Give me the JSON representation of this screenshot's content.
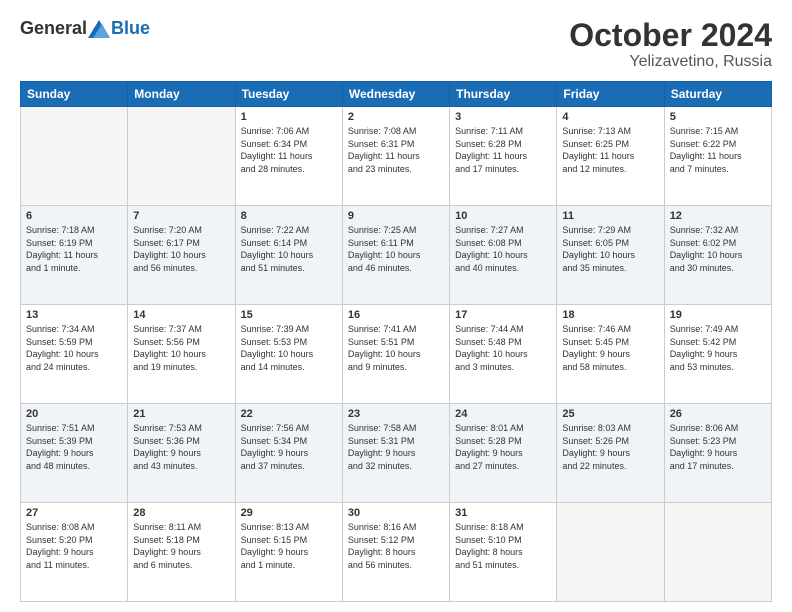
{
  "header": {
    "logo_general": "General",
    "logo_blue": "Blue",
    "month": "October 2024",
    "location": "Yelizavetino, Russia"
  },
  "days_of_week": [
    "Sunday",
    "Monday",
    "Tuesday",
    "Wednesday",
    "Thursday",
    "Friday",
    "Saturday"
  ],
  "weeks": [
    [
      {
        "day": "",
        "info": ""
      },
      {
        "day": "",
        "info": ""
      },
      {
        "day": "1",
        "info": "Sunrise: 7:06 AM\nSunset: 6:34 PM\nDaylight: 11 hours\nand 28 minutes."
      },
      {
        "day": "2",
        "info": "Sunrise: 7:08 AM\nSunset: 6:31 PM\nDaylight: 11 hours\nand 23 minutes."
      },
      {
        "day": "3",
        "info": "Sunrise: 7:11 AM\nSunset: 6:28 PM\nDaylight: 11 hours\nand 17 minutes."
      },
      {
        "day": "4",
        "info": "Sunrise: 7:13 AM\nSunset: 6:25 PM\nDaylight: 11 hours\nand 12 minutes."
      },
      {
        "day": "5",
        "info": "Sunrise: 7:15 AM\nSunset: 6:22 PM\nDaylight: 11 hours\nand 7 minutes."
      }
    ],
    [
      {
        "day": "6",
        "info": "Sunrise: 7:18 AM\nSunset: 6:19 PM\nDaylight: 11 hours\nand 1 minute."
      },
      {
        "day": "7",
        "info": "Sunrise: 7:20 AM\nSunset: 6:17 PM\nDaylight: 10 hours\nand 56 minutes."
      },
      {
        "day": "8",
        "info": "Sunrise: 7:22 AM\nSunset: 6:14 PM\nDaylight: 10 hours\nand 51 minutes."
      },
      {
        "day": "9",
        "info": "Sunrise: 7:25 AM\nSunset: 6:11 PM\nDaylight: 10 hours\nand 46 minutes."
      },
      {
        "day": "10",
        "info": "Sunrise: 7:27 AM\nSunset: 6:08 PM\nDaylight: 10 hours\nand 40 minutes."
      },
      {
        "day": "11",
        "info": "Sunrise: 7:29 AM\nSunset: 6:05 PM\nDaylight: 10 hours\nand 35 minutes."
      },
      {
        "day": "12",
        "info": "Sunrise: 7:32 AM\nSunset: 6:02 PM\nDaylight: 10 hours\nand 30 minutes."
      }
    ],
    [
      {
        "day": "13",
        "info": "Sunrise: 7:34 AM\nSunset: 5:59 PM\nDaylight: 10 hours\nand 24 minutes."
      },
      {
        "day": "14",
        "info": "Sunrise: 7:37 AM\nSunset: 5:56 PM\nDaylight: 10 hours\nand 19 minutes."
      },
      {
        "day": "15",
        "info": "Sunrise: 7:39 AM\nSunset: 5:53 PM\nDaylight: 10 hours\nand 14 minutes."
      },
      {
        "day": "16",
        "info": "Sunrise: 7:41 AM\nSunset: 5:51 PM\nDaylight: 10 hours\nand 9 minutes."
      },
      {
        "day": "17",
        "info": "Sunrise: 7:44 AM\nSunset: 5:48 PM\nDaylight: 10 hours\nand 3 minutes."
      },
      {
        "day": "18",
        "info": "Sunrise: 7:46 AM\nSunset: 5:45 PM\nDaylight: 9 hours\nand 58 minutes."
      },
      {
        "day": "19",
        "info": "Sunrise: 7:49 AM\nSunset: 5:42 PM\nDaylight: 9 hours\nand 53 minutes."
      }
    ],
    [
      {
        "day": "20",
        "info": "Sunrise: 7:51 AM\nSunset: 5:39 PM\nDaylight: 9 hours\nand 48 minutes."
      },
      {
        "day": "21",
        "info": "Sunrise: 7:53 AM\nSunset: 5:36 PM\nDaylight: 9 hours\nand 43 minutes."
      },
      {
        "day": "22",
        "info": "Sunrise: 7:56 AM\nSunset: 5:34 PM\nDaylight: 9 hours\nand 37 minutes."
      },
      {
        "day": "23",
        "info": "Sunrise: 7:58 AM\nSunset: 5:31 PM\nDaylight: 9 hours\nand 32 minutes."
      },
      {
        "day": "24",
        "info": "Sunrise: 8:01 AM\nSunset: 5:28 PM\nDaylight: 9 hours\nand 27 minutes."
      },
      {
        "day": "25",
        "info": "Sunrise: 8:03 AM\nSunset: 5:26 PM\nDaylight: 9 hours\nand 22 minutes."
      },
      {
        "day": "26",
        "info": "Sunrise: 8:06 AM\nSunset: 5:23 PM\nDaylight: 9 hours\nand 17 minutes."
      }
    ],
    [
      {
        "day": "27",
        "info": "Sunrise: 8:08 AM\nSunset: 5:20 PM\nDaylight: 9 hours\nand 11 minutes."
      },
      {
        "day": "28",
        "info": "Sunrise: 8:11 AM\nSunset: 5:18 PM\nDaylight: 9 hours\nand 6 minutes."
      },
      {
        "day": "29",
        "info": "Sunrise: 8:13 AM\nSunset: 5:15 PM\nDaylight: 9 hours\nand 1 minute."
      },
      {
        "day": "30",
        "info": "Sunrise: 8:16 AM\nSunset: 5:12 PM\nDaylight: 8 hours\nand 56 minutes."
      },
      {
        "day": "31",
        "info": "Sunrise: 8:18 AM\nSunset: 5:10 PM\nDaylight: 8 hours\nand 51 minutes."
      },
      {
        "day": "",
        "info": ""
      },
      {
        "day": "",
        "info": ""
      }
    ]
  ]
}
